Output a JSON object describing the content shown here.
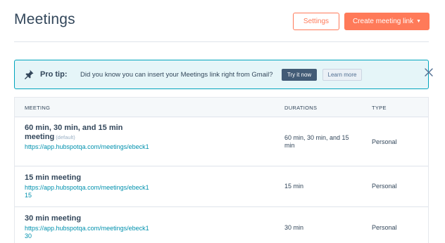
{
  "header": {
    "title": "Meetings",
    "settings_label": "Settings",
    "create_label": "Create meeting link"
  },
  "tip": {
    "icon": "pin-icon",
    "label": "Pro tip:",
    "text": "Did you know you can insert your Meetings link right from Gmail?",
    "try_label": "Try it now",
    "learn_label": "Learn more"
  },
  "table": {
    "columns": [
      "MEETING",
      "DURATIONS",
      "TYPE"
    ],
    "rows": [
      {
        "name": "60 min, 30 min, and 15 min meeting",
        "default_tag": "(default)",
        "link": "https://app.hubspotqa.com/meetings/ebeck1",
        "durations": "60 min, 30 min, and 15 min",
        "type": "Personal"
      },
      {
        "name": "15 min meeting",
        "link": "https://app.hubspotqa.com/meetings/ebeck115",
        "durations": "15 min",
        "type": "Personal"
      },
      {
        "name": "30 min meeting",
        "link": "https://app.hubspotqa.com/meetings/ebeck130",
        "durations": "30 min",
        "type": "Personal"
      }
    ]
  },
  "colors": {
    "accent": "#ff7a59",
    "tip_background": "#e5f5f8",
    "tip_border": "#00a4bd",
    "link": "#0091ae",
    "text": "#33475b"
  }
}
